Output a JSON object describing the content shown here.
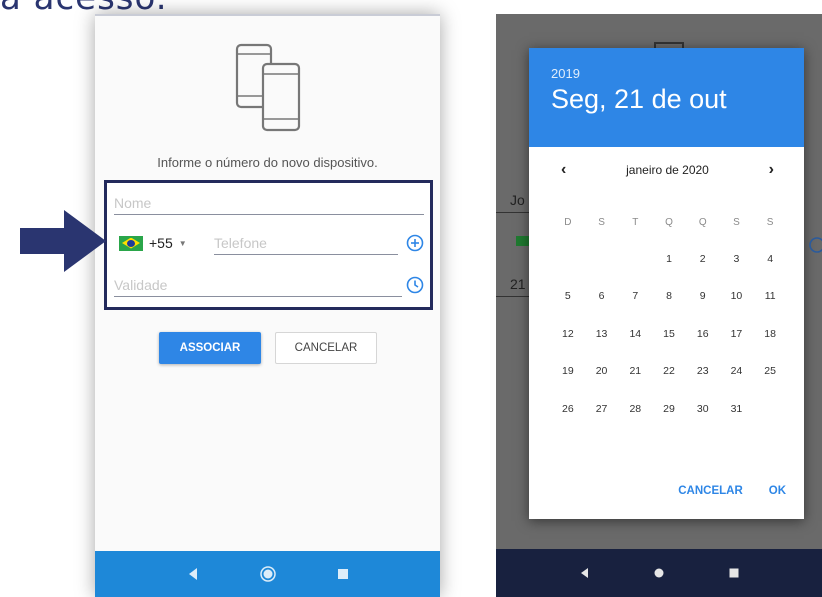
{
  "heading_cut": "a acesso.",
  "left": {
    "info_text": "Informe o número do novo dispositivo.",
    "name_placeholder": "Nome",
    "country_code": "+55",
    "phone_placeholder": "Telefone",
    "validity_placeholder": "Validade",
    "associate_label": "ASSOCIAR",
    "cancel_label": "CANCELAR"
  },
  "right": {
    "behind": {
      "text1": "Jo",
      "text2": "21"
    },
    "dialog": {
      "year": "2019",
      "selected_date": "Seg, 21 de out",
      "month_label": "janeiro de 2020",
      "prev": "‹",
      "next": "›",
      "weekdays": [
        "D",
        "S",
        "T",
        "Q",
        "Q",
        "S",
        "S"
      ],
      "weeks": [
        [
          "",
          "",
          "",
          "1",
          "2",
          "3",
          "4"
        ],
        [
          "5",
          "6",
          "7",
          "8",
          "9",
          "10",
          "11"
        ],
        [
          "12",
          "13",
          "14",
          "15",
          "16",
          "17",
          "18"
        ],
        [
          "19",
          "20",
          "21",
          "22",
          "23",
          "24",
          "25"
        ],
        [
          "26",
          "27",
          "28",
          "29",
          "30",
          "31",
          ""
        ]
      ],
      "cancel_label": "CANCELAR",
      "ok_label": "OK"
    }
  },
  "colors": {
    "accent": "#2e86e6",
    "frame": "#232a5c",
    "nav_left": "#1e88d8",
    "nav_right": "#18213f"
  }
}
